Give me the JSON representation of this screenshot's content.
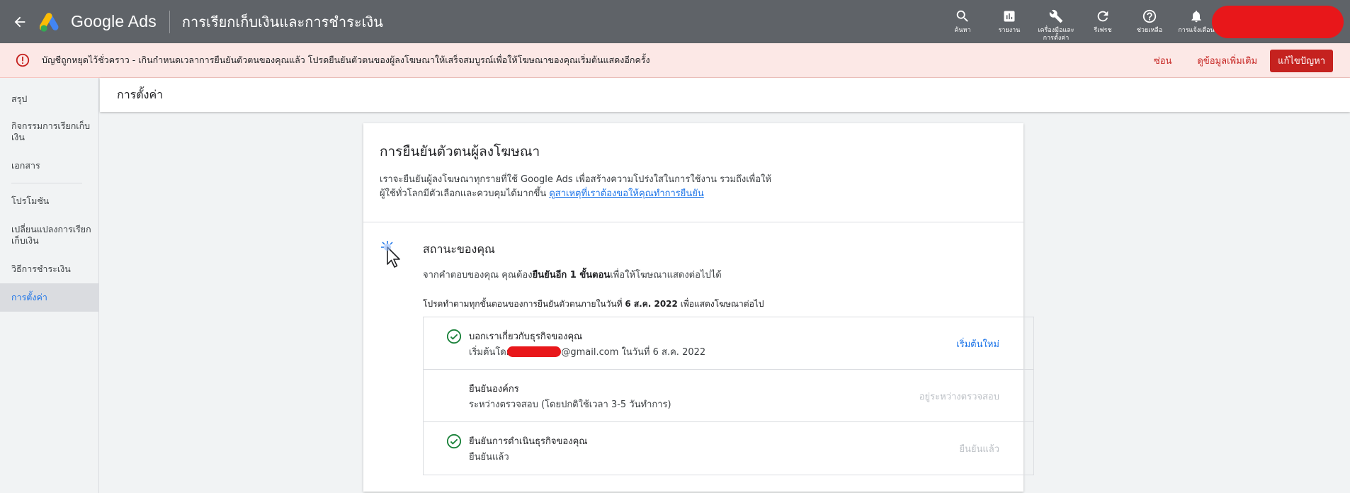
{
  "topbar": {
    "app_name": "Google Ads",
    "page_title": "การเรียกเก็บเงินและการชำระเงิน",
    "actions": [
      {
        "label": "ค้นหา",
        "icon": "search-icon"
      },
      {
        "label": "รายงาน",
        "icon": "reports-icon"
      },
      {
        "label": "เครื่องมือและการตั้งค่า",
        "icon": "wrench-icon"
      },
      {
        "label": "รีเฟรช",
        "icon": "refresh-icon"
      },
      {
        "label": "ช่วยเหลือ",
        "icon": "help-icon"
      },
      {
        "label": "การแจ้งเตือน",
        "icon": "bell-icon"
      }
    ]
  },
  "alert": {
    "text": "บัญชีถูกหยุดไว้ชั่วคราว - เกินกำหนดเวลาการยืนยันตัวตนของคุณแล้ว โปรดยืนยันตัวตนของผู้ลงโฆษณาให้เสร็จสมบูรณ์เพื่อให้โฆษณาของคุณเริ่มต้นแสดงอีกครั้ง",
    "hide_label": "ซ่อน",
    "more_label": "ดูข้อมูลเพิ่มเติม",
    "fix_label": "แก้ไขปัญหา"
  },
  "sidebar": {
    "items": [
      {
        "label": "สรุป"
      },
      {
        "label": "กิจกรรมการเรียกเก็บเงิน"
      },
      {
        "label": "เอกสาร"
      },
      {
        "label": "โปรโมชัน"
      },
      {
        "label": "เปลี่ยนแปลงการเรียกเก็บเงิน"
      },
      {
        "label": "วิธีการชำระเงิน"
      },
      {
        "label": "การตั้งค่า"
      }
    ]
  },
  "settings_header": "การตั้งค่า",
  "card": {
    "title": "การยืนยันตัวตนผู้ลงโฆษณา",
    "desc_line1": "เราจะยืนยันผู้ลงโฆษณาทุกรายที่ใช้ Google Ads เพื่อสร้างความโปร่งใสในการใช้งาน รวมถึงเพื่อให้",
    "desc_line2": "ผู้ใช้ทั่วโลกมีตัวเลือกและควบคุมได้มากขึ้น",
    "desc_link": "ดูสาเหตุที่เราต้องขอให้คุณทำการยืนยัน",
    "status_title": "สถานะของคุณ",
    "status_pre": "จากคำตอบของคุณ คุณต้อง",
    "status_bold": "ยืนยันอีก 1 ขั้นตอน",
    "status_post": "เพื่อให้โฆษณาแสดงต่อไปได้",
    "deadline_pre": "โปรดทำตามทุกขั้นตอนของการยืนยันตัวตนภายในวันที่",
    "deadline_date": "6 ส.ค. 2022",
    "deadline_post": "เพื่อแสดงโฆษณาต่อไป",
    "steps": [
      {
        "title": "บอกเราเกี่ยวกับธุรกิจของคุณ",
        "sub_pre": "เริ่มต้นโดย",
        "sub_post": "@gmail.com ในวันที่ 6 ส.ค. 2022",
        "action": "เริ่มต้นใหม่",
        "status": "done"
      },
      {
        "title": "ยืนยันองค์กร",
        "sub": "ระหว่างตรวจสอบ (โดยปกติใช้เวลา 3-5 วันทำการ)",
        "action": "อยู่ระหว่างตรวจสอบ",
        "status": "pending"
      },
      {
        "title": "ยืนยันการดำเนินธุรกิจของคุณ",
        "sub": "ยืนยันแล้ว",
        "action": "ยืนยันแล้ว",
        "status": "done"
      }
    ]
  },
  "colors": {
    "topbar": "#5f6368",
    "alert_bg": "#fce8e6",
    "alert_red": "#c5221f",
    "link_blue": "#1a73e8",
    "check_green": "#188038"
  }
}
